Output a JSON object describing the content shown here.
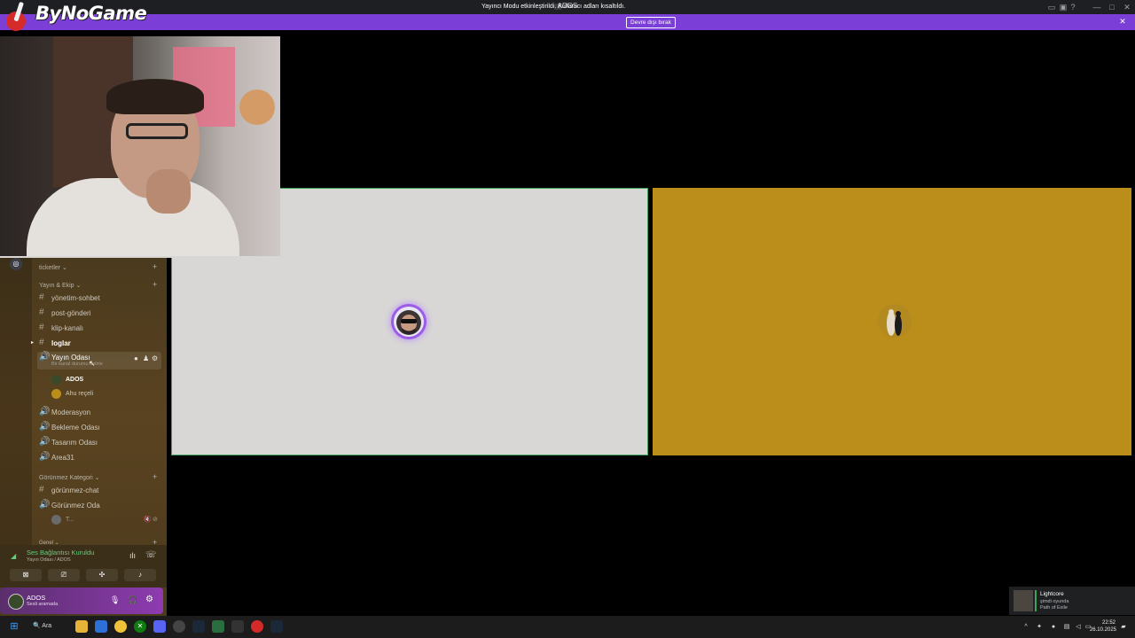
{
  "window": {
    "title": "ADOS"
  },
  "banner": {
    "message": "Yayıncı Modu etkinleştirildi. Kullanıcı adları kısaltıldı.",
    "button_label": "Devre dışı bırak"
  },
  "overlay": {
    "logo_text": "ByNoGame"
  },
  "sidebar": {
    "categories": [
      {
        "label": "ticketler ⌄"
      },
      {
        "label": "Yayın & Ekip ⌄"
      },
      {
        "label": "Görünmez Kategori ⌄"
      },
      {
        "label": "Genel ⌄"
      }
    ],
    "channels": [
      {
        "label": "yönetim-sohbet"
      },
      {
        "label": "post-gönderi"
      },
      {
        "label": "klip-kanalı"
      },
      {
        "label": "loglar"
      },
      {
        "label": "Yayın Odası",
        "sublabel": "Bir kanal durumu belirle"
      },
      {
        "label": "Moderasyon"
      },
      {
        "label": "Bekleme Odası"
      },
      {
        "label": "Tasarım Odası"
      },
      {
        "label": "Area31"
      },
      {
        "label": "görünmez-chat"
      },
      {
        "label": "Görünmez Oda"
      }
    ],
    "voice_users": [
      {
        "name": "ADOS"
      },
      {
        "name": "Ahu reçeli"
      },
      {
        "name": "T..."
      }
    ]
  },
  "voice_panel": {
    "status": "Ses Bağlantısı Kuruldu",
    "location": "Yayın Odası / ADOS"
  },
  "user_panel": {
    "username": "ADOS",
    "status": "Sesli aramada"
  },
  "activity": {
    "name": "Lightcore",
    "status": "şimdi oyunda",
    "game": "Path of Exile"
  },
  "taskbar": {
    "search_label": "Ara",
    "time": "22:52",
    "date": "26.10.2025"
  },
  "colors": {
    "banner": "#7b3fd7",
    "tile_active_border": "#3ba55d",
    "tile2_bg": "#bb8e1c",
    "voice_connected": "#5fcf7a"
  }
}
